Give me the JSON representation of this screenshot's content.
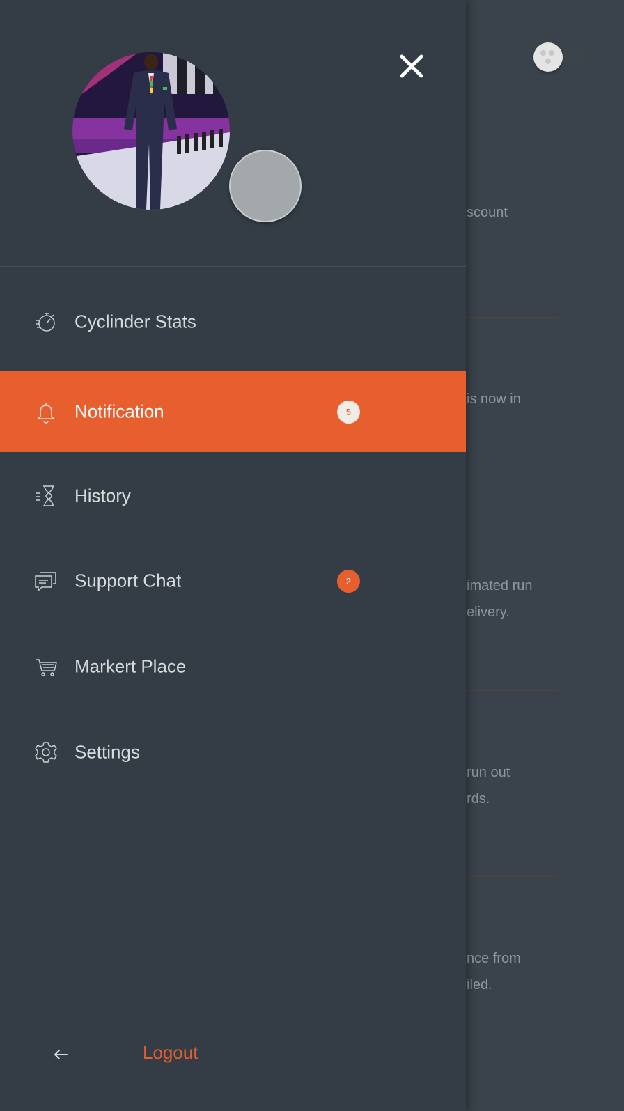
{
  "background": {
    "text_lines": [
      "scount",
      "is now in",
      "imated run",
      "elivery.",
      "run out",
      "rds.",
      "nce from",
      "iled."
    ]
  },
  "drawer": {
    "menu": [
      {
        "label": "Cyclinder Stats",
        "icon": "stopwatch-icon",
        "badge": null,
        "active": false
      },
      {
        "label": "Notification",
        "icon": "bell-icon",
        "badge": "5",
        "active": true
      },
      {
        "label": "History",
        "icon": "hourglass-icon",
        "badge": null,
        "active": false
      },
      {
        "label": "Support Chat",
        "icon": "chat-icon",
        "badge": "2",
        "active": false
      },
      {
        "label": "Markert Place",
        "icon": "cart-icon",
        "badge": null,
        "active": false
      },
      {
        "label": "Settings",
        "icon": "gear-icon",
        "badge": null,
        "active": false
      }
    ],
    "logout_label": "Logout"
  },
  "colors": {
    "accent": "#e75e2f",
    "drawer_bg": "#343d46",
    "page_bg": "#3a434b",
    "text": "#d6dadd"
  }
}
